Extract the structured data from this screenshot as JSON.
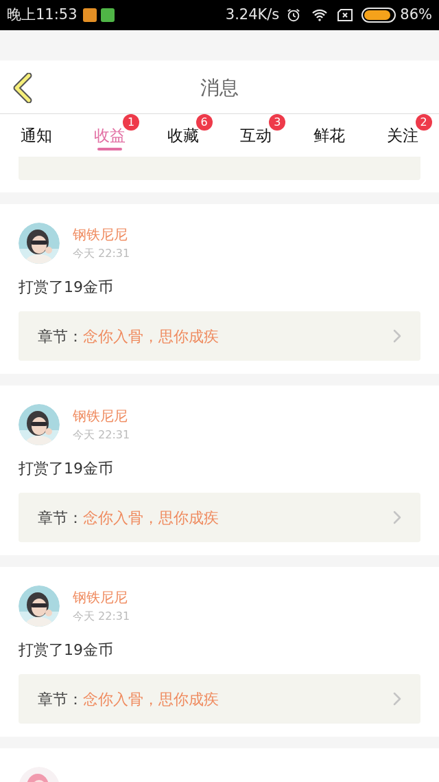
{
  "status_bar": {
    "time": "晚上11:53",
    "speed": "3.24K/s",
    "battery": "86%"
  },
  "header": {
    "title": "消息"
  },
  "tabs": [
    {
      "label": "通知",
      "selected": false
    },
    {
      "label": "收益",
      "selected": true,
      "badge": "1"
    },
    {
      "label": "收藏",
      "selected": false,
      "badge": "6"
    },
    {
      "label": "互动",
      "selected": false,
      "badge": "3"
    },
    {
      "label": "鲜花",
      "selected": false
    },
    {
      "label": "关注",
      "selected": false,
      "badge": "2"
    }
  ],
  "messages": [
    {
      "kind": "reward",
      "name": "钢铁尼尼",
      "time": "今天 22:31",
      "text": "打赏了19金币",
      "chapter_label": "章节：",
      "chapter": "念你入骨，思你成疾"
    },
    {
      "kind": "reward",
      "name": "钢铁尼尼",
      "time": "今天 22:31",
      "text": "打赏了19金币",
      "chapter_label": "章节：",
      "chapter": "念你入骨，思你成疾"
    },
    {
      "kind": "reward",
      "name": "钢铁尼尼",
      "time": "今天 22:31",
      "text": "打赏了19金币",
      "chapter_label": "章节：",
      "chapter": "念你入骨，思你成疾"
    },
    {
      "kind": "partial"
    }
  ]
}
